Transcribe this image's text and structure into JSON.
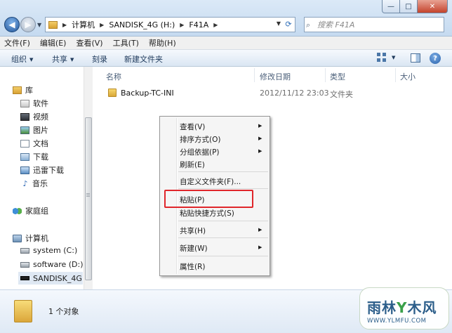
{
  "address": {
    "crumbs": [
      "计算机",
      "SANDISK_4G (H:)",
      "F41A"
    ]
  },
  "search": {
    "placeholder": "搜索 F41A"
  },
  "window_controls": {
    "minimize": "—",
    "maximize": "□",
    "close": "✕"
  },
  "menu": [
    "文件(F)",
    "编辑(E)",
    "查看(V)",
    "工具(T)",
    "帮助(H)"
  ],
  "toolbar": {
    "organize": "组织",
    "share": "共享",
    "burn": "刻录",
    "new_folder": "新建文件夹"
  },
  "nav": {
    "libraries": "库",
    "lib_items": [
      "软件",
      "视频",
      "图片",
      "文档",
      "下载",
      "迅雷下载",
      "音乐"
    ],
    "homegroup": "家庭组",
    "computer": "计算机",
    "drives": [
      "system (C:)",
      "software (D:)",
      "SANDISK_4G (H:"
    ]
  },
  "columns": {
    "name": "名称",
    "date": "修改日期",
    "type": "类型",
    "size": "大小"
  },
  "files": [
    {
      "name": "Backup-TC-INI",
      "date": "2012/11/12 23:03",
      "type": "文件夹"
    }
  ],
  "context_menu": {
    "view": "查看(V)",
    "sort": "排序方式(O)",
    "group": "分组依据(P)",
    "refresh": "刷新(E)",
    "customize": "自定义文件夹(F)...",
    "paste": "粘贴(P)",
    "paste_shortcut": "粘贴快捷方式(S)",
    "share": "共享(H)",
    "new": "新建(W)",
    "properties": "属性(R)"
  },
  "status": {
    "count": "1 个对象"
  },
  "watermark": {
    "main_a": "雨林",
    "main_y": "Y",
    "main_b": "木风",
    "sub": "WWW.YLMFU.COM"
  },
  "colors": {
    "highlight_box": "#e0262b",
    "accent": "#2c5e8a"
  }
}
